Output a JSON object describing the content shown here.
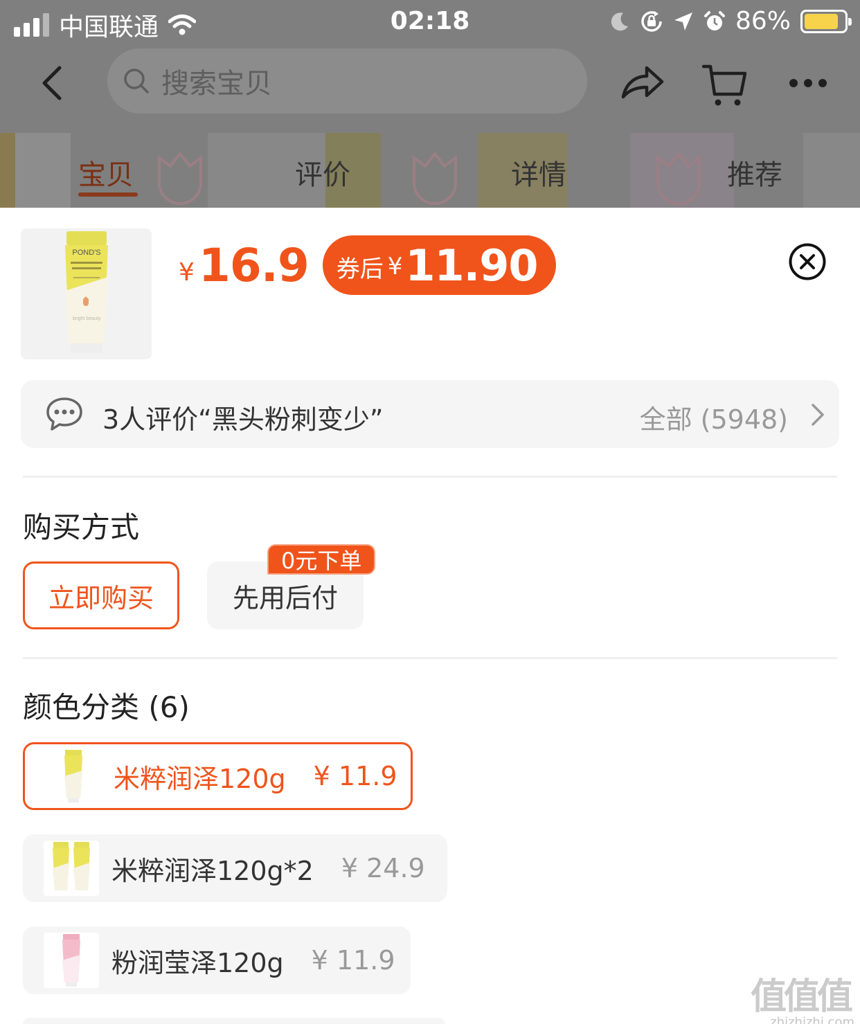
{
  "status_bar": {
    "carrier": "中国联通",
    "time": "02:18",
    "battery_percent": "86%",
    "battery_level": 0.86,
    "icons": [
      "signal-icon",
      "wifi-icon",
      "moon-icon",
      "orientation-lock-icon",
      "location-icon",
      "alarm-icon",
      "battery-icon"
    ]
  },
  "nav": {
    "search_placeholder": "搜索宝贝",
    "icons": [
      "back-icon",
      "search-icon",
      "share-icon",
      "cart-icon",
      "more-icon"
    ]
  },
  "tabs": [
    {
      "label": "宝贝",
      "active": true
    },
    {
      "label": "评价",
      "active": false
    },
    {
      "label": "详情",
      "active": false
    },
    {
      "label": "推荐",
      "active": false
    }
  ],
  "product": {
    "currency": "¥",
    "price": "16.9",
    "coupon_label": "券后",
    "coupon_currency": "¥",
    "coupon_price": "11.90",
    "thumb_brand": "POND'S",
    "thumb_tagline": "bright beauty"
  },
  "review": {
    "summary": "3人评价“黑头粉刺变少”",
    "all_label": "全部 (5948)"
  },
  "purchase": {
    "title": "购买方式",
    "options": [
      {
        "label": "立即购买",
        "selected": true
      },
      {
        "label": "先用后付",
        "selected": false
      }
    ],
    "badge": "0元下单"
  },
  "color": {
    "title": "颜色分类 (6)",
    "items": [
      {
        "name": "米粹润泽120g",
        "price": "¥ 11.9",
        "selected": true
      },
      {
        "name": "米粹润泽120g*2",
        "price": "¥ 24.9",
        "selected": false
      },
      {
        "name": "粉润莹泽120g",
        "price": "¥ 11.9",
        "selected": false
      }
    ]
  },
  "watermark": {
    "glyphs": "值值值",
    "url": "zhizhizhi.com"
  },
  "colors": {
    "accent": "#f0541b",
    "overlay": "#7f7f7f",
    "chip_bg": "#f5f5f5",
    "battery_fill": "#f6d34a",
    "tube_yellow": "#e9e04f",
    "tube_pink": "#f2b6c6"
  }
}
